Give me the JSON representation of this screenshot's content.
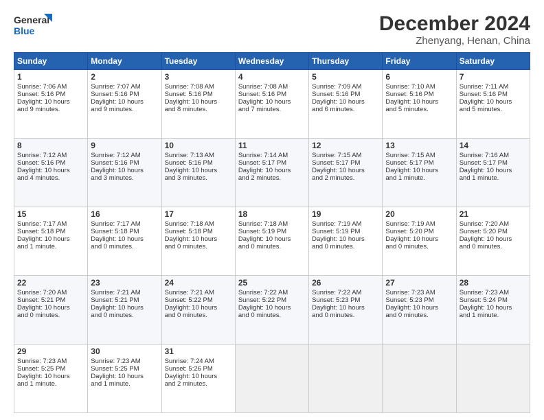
{
  "logo": {
    "line1": "General",
    "line2": "Blue"
  },
  "title": "December 2024",
  "subtitle": "Zhenyang, Henan, China",
  "days_header": [
    "Sunday",
    "Monday",
    "Tuesday",
    "Wednesday",
    "Thursday",
    "Friday",
    "Saturday"
  ],
  "weeks": [
    [
      {
        "day": "1",
        "lines": [
          "Sunrise: 7:06 AM",
          "Sunset: 5:16 PM",
          "Daylight: 10 hours",
          "and 9 minutes."
        ]
      },
      {
        "day": "2",
        "lines": [
          "Sunrise: 7:07 AM",
          "Sunset: 5:16 PM",
          "Daylight: 10 hours",
          "and 9 minutes."
        ]
      },
      {
        "day": "3",
        "lines": [
          "Sunrise: 7:08 AM",
          "Sunset: 5:16 PM",
          "Daylight: 10 hours",
          "and 8 minutes."
        ]
      },
      {
        "day": "4",
        "lines": [
          "Sunrise: 7:08 AM",
          "Sunset: 5:16 PM",
          "Daylight: 10 hours",
          "and 7 minutes."
        ]
      },
      {
        "day": "5",
        "lines": [
          "Sunrise: 7:09 AM",
          "Sunset: 5:16 PM",
          "Daylight: 10 hours",
          "and 6 minutes."
        ]
      },
      {
        "day": "6",
        "lines": [
          "Sunrise: 7:10 AM",
          "Sunset: 5:16 PM",
          "Daylight: 10 hours",
          "and 5 minutes."
        ]
      },
      {
        "day": "7",
        "lines": [
          "Sunrise: 7:11 AM",
          "Sunset: 5:16 PM",
          "Daylight: 10 hours",
          "and 5 minutes."
        ]
      }
    ],
    [
      {
        "day": "8",
        "lines": [
          "Sunrise: 7:12 AM",
          "Sunset: 5:16 PM",
          "Daylight: 10 hours",
          "and 4 minutes."
        ]
      },
      {
        "day": "9",
        "lines": [
          "Sunrise: 7:12 AM",
          "Sunset: 5:16 PM",
          "Daylight: 10 hours",
          "and 3 minutes."
        ]
      },
      {
        "day": "10",
        "lines": [
          "Sunrise: 7:13 AM",
          "Sunset: 5:16 PM",
          "Daylight: 10 hours",
          "and 3 minutes."
        ]
      },
      {
        "day": "11",
        "lines": [
          "Sunrise: 7:14 AM",
          "Sunset: 5:17 PM",
          "Daylight: 10 hours",
          "and 2 minutes."
        ]
      },
      {
        "day": "12",
        "lines": [
          "Sunrise: 7:15 AM",
          "Sunset: 5:17 PM",
          "Daylight: 10 hours",
          "and 2 minutes."
        ]
      },
      {
        "day": "13",
        "lines": [
          "Sunrise: 7:15 AM",
          "Sunset: 5:17 PM",
          "Daylight: 10 hours",
          "and 1 minute."
        ]
      },
      {
        "day": "14",
        "lines": [
          "Sunrise: 7:16 AM",
          "Sunset: 5:17 PM",
          "Daylight: 10 hours",
          "and 1 minute."
        ]
      }
    ],
    [
      {
        "day": "15",
        "lines": [
          "Sunrise: 7:17 AM",
          "Sunset: 5:18 PM",
          "Daylight: 10 hours",
          "and 1 minute."
        ]
      },
      {
        "day": "16",
        "lines": [
          "Sunrise: 7:17 AM",
          "Sunset: 5:18 PM",
          "Daylight: 10 hours",
          "and 0 minutes."
        ]
      },
      {
        "day": "17",
        "lines": [
          "Sunrise: 7:18 AM",
          "Sunset: 5:18 PM",
          "Daylight: 10 hours",
          "and 0 minutes."
        ]
      },
      {
        "day": "18",
        "lines": [
          "Sunrise: 7:18 AM",
          "Sunset: 5:19 PM",
          "Daylight: 10 hours",
          "and 0 minutes."
        ]
      },
      {
        "day": "19",
        "lines": [
          "Sunrise: 7:19 AM",
          "Sunset: 5:19 PM",
          "Daylight: 10 hours",
          "and 0 minutes."
        ]
      },
      {
        "day": "20",
        "lines": [
          "Sunrise: 7:19 AM",
          "Sunset: 5:20 PM",
          "Daylight: 10 hours",
          "and 0 minutes."
        ]
      },
      {
        "day": "21",
        "lines": [
          "Sunrise: 7:20 AM",
          "Sunset: 5:20 PM",
          "Daylight: 10 hours",
          "and 0 minutes."
        ]
      }
    ],
    [
      {
        "day": "22",
        "lines": [
          "Sunrise: 7:20 AM",
          "Sunset: 5:21 PM",
          "Daylight: 10 hours",
          "and 0 minutes."
        ]
      },
      {
        "day": "23",
        "lines": [
          "Sunrise: 7:21 AM",
          "Sunset: 5:21 PM",
          "Daylight: 10 hours",
          "and 0 minutes."
        ]
      },
      {
        "day": "24",
        "lines": [
          "Sunrise: 7:21 AM",
          "Sunset: 5:22 PM",
          "Daylight: 10 hours",
          "and 0 minutes."
        ]
      },
      {
        "day": "25",
        "lines": [
          "Sunrise: 7:22 AM",
          "Sunset: 5:22 PM",
          "Daylight: 10 hours",
          "and 0 minutes."
        ]
      },
      {
        "day": "26",
        "lines": [
          "Sunrise: 7:22 AM",
          "Sunset: 5:23 PM",
          "Daylight: 10 hours",
          "and 0 minutes."
        ]
      },
      {
        "day": "27",
        "lines": [
          "Sunrise: 7:23 AM",
          "Sunset: 5:23 PM",
          "Daylight: 10 hours",
          "and 0 minutes."
        ]
      },
      {
        "day": "28",
        "lines": [
          "Sunrise: 7:23 AM",
          "Sunset: 5:24 PM",
          "Daylight: 10 hours",
          "and 1 minute."
        ]
      }
    ],
    [
      {
        "day": "29",
        "lines": [
          "Sunrise: 7:23 AM",
          "Sunset: 5:25 PM",
          "Daylight: 10 hours",
          "and 1 minute."
        ]
      },
      {
        "day": "30",
        "lines": [
          "Sunrise: 7:23 AM",
          "Sunset: 5:25 PM",
          "Daylight: 10 hours",
          "and 1 minute."
        ]
      },
      {
        "day": "31",
        "lines": [
          "Sunrise: 7:24 AM",
          "Sunset: 5:26 PM",
          "Daylight: 10 hours",
          "and 2 minutes."
        ]
      },
      {
        "day": "",
        "lines": []
      },
      {
        "day": "",
        "lines": []
      },
      {
        "day": "",
        "lines": []
      },
      {
        "day": "",
        "lines": []
      }
    ]
  ]
}
